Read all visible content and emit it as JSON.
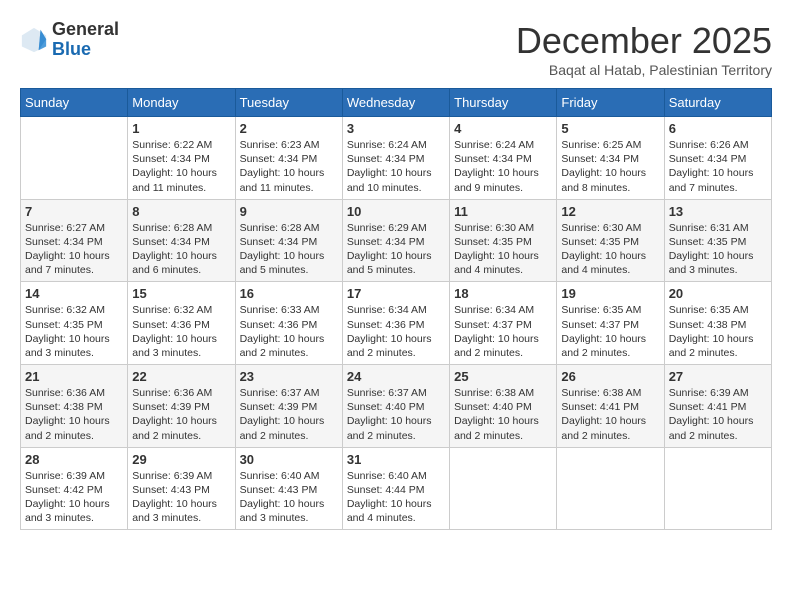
{
  "logo": {
    "general": "General",
    "blue": "Blue"
  },
  "title": "December 2025",
  "subtitle": "Baqat al Hatab, Palestinian Territory",
  "headers": [
    "Sunday",
    "Monday",
    "Tuesday",
    "Wednesday",
    "Thursday",
    "Friday",
    "Saturday"
  ],
  "weeks": [
    [
      {
        "day": "",
        "info": ""
      },
      {
        "day": "1",
        "info": "Sunrise: 6:22 AM\nSunset: 4:34 PM\nDaylight: 10 hours and 11 minutes."
      },
      {
        "day": "2",
        "info": "Sunrise: 6:23 AM\nSunset: 4:34 PM\nDaylight: 10 hours and 11 minutes."
      },
      {
        "day": "3",
        "info": "Sunrise: 6:24 AM\nSunset: 4:34 PM\nDaylight: 10 hours and 10 minutes."
      },
      {
        "day": "4",
        "info": "Sunrise: 6:24 AM\nSunset: 4:34 PM\nDaylight: 10 hours and 9 minutes."
      },
      {
        "day": "5",
        "info": "Sunrise: 6:25 AM\nSunset: 4:34 PM\nDaylight: 10 hours and 8 minutes."
      },
      {
        "day": "6",
        "info": "Sunrise: 6:26 AM\nSunset: 4:34 PM\nDaylight: 10 hours and 7 minutes."
      }
    ],
    [
      {
        "day": "7",
        "info": "Sunrise: 6:27 AM\nSunset: 4:34 PM\nDaylight: 10 hours and 7 minutes."
      },
      {
        "day": "8",
        "info": "Sunrise: 6:28 AM\nSunset: 4:34 PM\nDaylight: 10 hours and 6 minutes."
      },
      {
        "day": "9",
        "info": "Sunrise: 6:28 AM\nSunset: 4:34 PM\nDaylight: 10 hours and 5 minutes."
      },
      {
        "day": "10",
        "info": "Sunrise: 6:29 AM\nSunset: 4:34 PM\nDaylight: 10 hours and 5 minutes."
      },
      {
        "day": "11",
        "info": "Sunrise: 6:30 AM\nSunset: 4:35 PM\nDaylight: 10 hours and 4 minutes."
      },
      {
        "day": "12",
        "info": "Sunrise: 6:30 AM\nSunset: 4:35 PM\nDaylight: 10 hours and 4 minutes."
      },
      {
        "day": "13",
        "info": "Sunrise: 6:31 AM\nSunset: 4:35 PM\nDaylight: 10 hours and 3 minutes."
      }
    ],
    [
      {
        "day": "14",
        "info": "Sunrise: 6:32 AM\nSunset: 4:35 PM\nDaylight: 10 hours and 3 minutes."
      },
      {
        "day": "15",
        "info": "Sunrise: 6:32 AM\nSunset: 4:36 PM\nDaylight: 10 hours and 3 minutes."
      },
      {
        "day": "16",
        "info": "Sunrise: 6:33 AM\nSunset: 4:36 PM\nDaylight: 10 hours and 2 minutes."
      },
      {
        "day": "17",
        "info": "Sunrise: 6:34 AM\nSunset: 4:36 PM\nDaylight: 10 hours and 2 minutes."
      },
      {
        "day": "18",
        "info": "Sunrise: 6:34 AM\nSunset: 4:37 PM\nDaylight: 10 hours and 2 minutes."
      },
      {
        "day": "19",
        "info": "Sunrise: 6:35 AM\nSunset: 4:37 PM\nDaylight: 10 hours and 2 minutes."
      },
      {
        "day": "20",
        "info": "Sunrise: 6:35 AM\nSunset: 4:38 PM\nDaylight: 10 hours and 2 minutes."
      }
    ],
    [
      {
        "day": "21",
        "info": "Sunrise: 6:36 AM\nSunset: 4:38 PM\nDaylight: 10 hours and 2 minutes."
      },
      {
        "day": "22",
        "info": "Sunrise: 6:36 AM\nSunset: 4:39 PM\nDaylight: 10 hours and 2 minutes."
      },
      {
        "day": "23",
        "info": "Sunrise: 6:37 AM\nSunset: 4:39 PM\nDaylight: 10 hours and 2 minutes."
      },
      {
        "day": "24",
        "info": "Sunrise: 6:37 AM\nSunset: 4:40 PM\nDaylight: 10 hours and 2 minutes."
      },
      {
        "day": "25",
        "info": "Sunrise: 6:38 AM\nSunset: 4:40 PM\nDaylight: 10 hours and 2 minutes."
      },
      {
        "day": "26",
        "info": "Sunrise: 6:38 AM\nSunset: 4:41 PM\nDaylight: 10 hours and 2 minutes."
      },
      {
        "day": "27",
        "info": "Sunrise: 6:39 AM\nSunset: 4:41 PM\nDaylight: 10 hours and 2 minutes."
      }
    ],
    [
      {
        "day": "28",
        "info": "Sunrise: 6:39 AM\nSunset: 4:42 PM\nDaylight: 10 hours and 3 minutes."
      },
      {
        "day": "29",
        "info": "Sunrise: 6:39 AM\nSunset: 4:43 PM\nDaylight: 10 hours and 3 minutes."
      },
      {
        "day": "30",
        "info": "Sunrise: 6:40 AM\nSunset: 4:43 PM\nDaylight: 10 hours and 3 minutes."
      },
      {
        "day": "31",
        "info": "Sunrise: 6:40 AM\nSunset: 4:44 PM\nDaylight: 10 hours and 4 minutes."
      },
      {
        "day": "",
        "info": ""
      },
      {
        "day": "",
        "info": ""
      },
      {
        "day": "",
        "info": ""
      }
    ]
  ]
}
